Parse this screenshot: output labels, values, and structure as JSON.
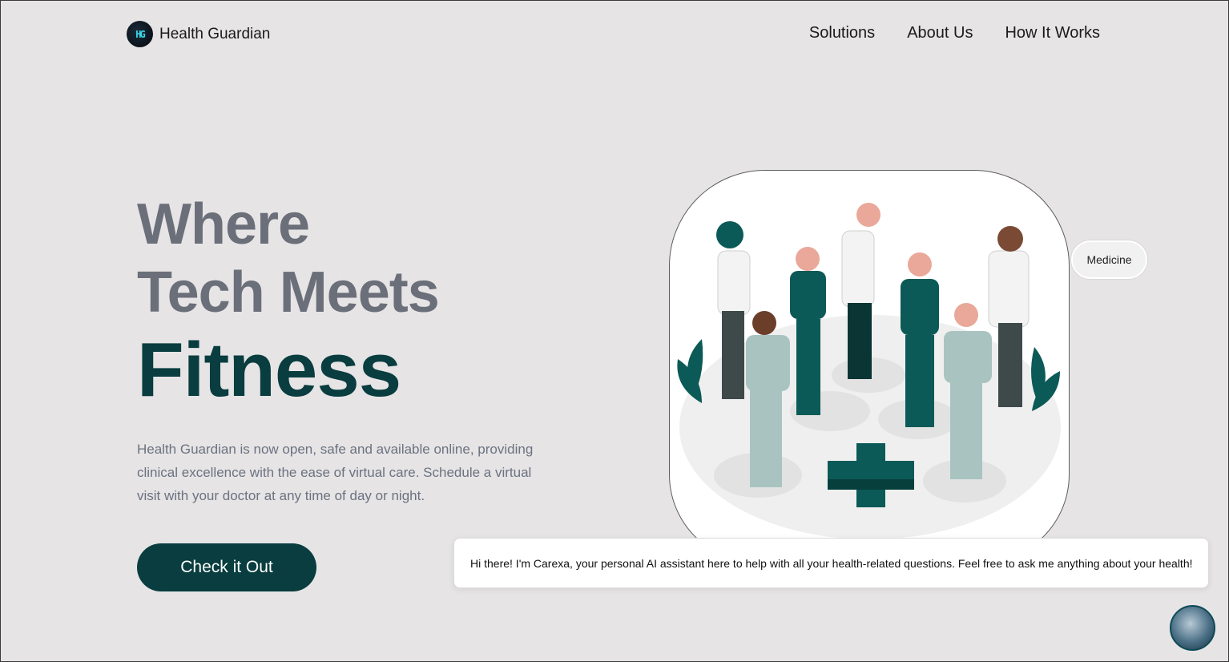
{
  "nav": {
    "logo_mark": "HG",
    "brand": "Health Guardian",
    "links": [
      "Solutions",
      "About Us",
      "How It Works"
    ]
  },
  "hero": {
    "line1": "Where",
    "line2": "Tech Meets",
    "line3": "Fitness",
    "description": "Health Guardian is now open, safe and available online, providing clinical excellence with the ease of virtual care. Schedule a virtual visit with your doctor at any time of day or night.",
    "cta": "Check it Out"
  },
  "illustration": {
    "badge": "Medicine"
  },
  "chat": {
    "message": "Hi there! I'm Carexa, your personal AI assistant here to help with all your health-related questions. Feel free to ask me anything about your health!"
  },
  "colors": {
    "background": "#e6e4e5",
    "primary": "#093d3f",
    "heading_gray": "#6b6f7a",
    "teal": "#0b5a57"
  }
}
